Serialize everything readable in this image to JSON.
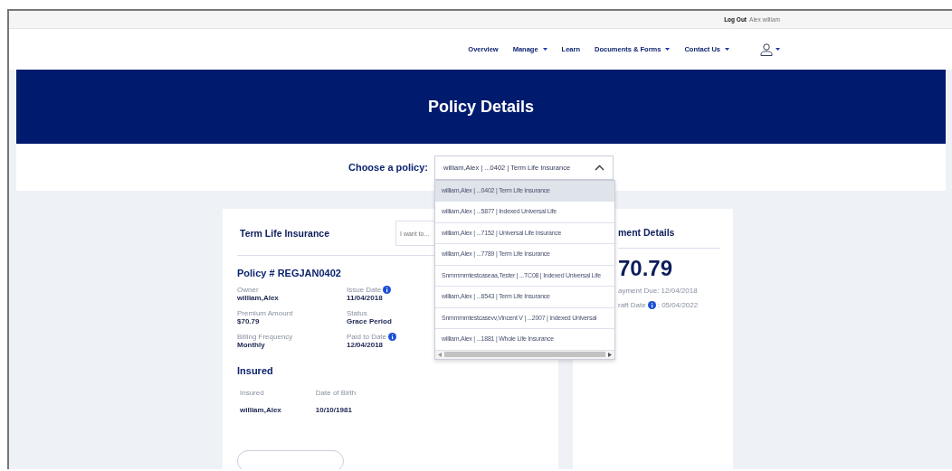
{
  "top_bar": {
    "logout": "Log Out",
    "user": "Alex william"
  },
  "nav": {
    "items": [
      {
        "label": "Overview",
        "has_menu": false
      },
      {
        "label": "Manage",
        "has_menu": true
      },
      {
        "label": "Learn",
        "has_menu": false
      },
      {
        "label": "Documents & Forms",
        "has_menu": true
      },
      {
        "label": "Contact Us",
        "has_menu": true
      }
    ]
  },
  "banner": {
    "title": "Policy Details"
  },
  "policy_chooser": {
    "label": "Choose a policy:",
    "value": "william,Alex | ...0402 | Term Life Insurance",
    "expanded": true,
    "options": [
      {
        "label": "william,Alex | ...0402 | Term Life Insurance",
        "selected": true
      },
      {
        "label": "william,Alex | ...5877 | Indexed Universal Life",
        "selected": false
      },
      {
        "label": "william,Alex | ...7152 | Universal Life Insurance",
        "selected": false
      },
      {
        "label": "william,Alex | ...7789 | Term Life Insurance",
        "selected": false
      },
      {
        "label": "Snmmmmtestcaseaa,Tester | ...TC08 | Indexed Universal Life",
        "selected": false
      },
      {
        "label": "william,Alex | ...6543 | Term Life Insurance",
        "selected": false
      },
      {
        "label": "Snmmmmtestcasevv,Vincent V | ...2007 | Indexed Universal",
        "selected": false
      },
      {
        "label": "william,Alex | ...1881 | Whole Life Insurance",
        "selected": false
      }
    ]
  },
  "policy_card": {
    "title": "Term Life Insurance",
    "action_placeholder": "I want to...",
    "policy_number": "Policy # REGJAN0402",
    "fields": [
      {
        "label": "Owner",
        "value": "william,Alex",
        "info": false
      },
      {
        "label": "Issue Date",
        "value": "11/04/2018",
        "info": true
      },
      {
        "label": "Premium Amount",
        "value": "$70.79",
        "info": false
      },
      {
        "label": "Status",
        "value": "Grace Period",
        "info": false
      },
      {
        "label": "Billing Frequency",
        "value": "Monthly",
        "info": false
      },
      {
        "label": "Paid to Date",
        "value": "12/04/2018",
        "info": true
      }
    ],
    "insured": {
      "title": "Insured",
      "columns": [
        "Insured",
        "Date of Birth"
      ],
      "rows": [
        [
          "william,Alex",
          "10/10/1981"
        ]
      ]
    }
  },
  "payment_card": {
    "title": "ment Details",
    "amount": "70.79",
    "lines": [
      {
        "label": "ayment Due: 12/04/2018",
        "info": false
      },
      {
        "label": "raft Date",
        "info": true,
        "value": ": 05/04/2022"
      }
    ]
  }
}
